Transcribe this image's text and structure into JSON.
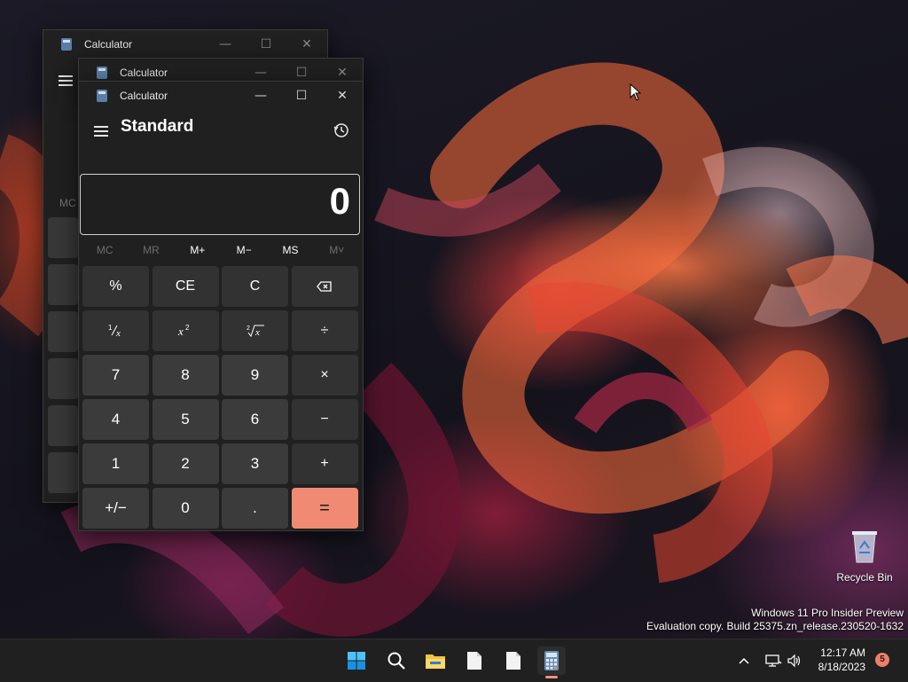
{
  "windows": {
    "back": {
      "title": "Calculator",
      "ghost_label": "MC"
    },
    "middle": {
      "title": "Calculator"
    },
    "front": {
      "title": "Calculator"
    }
  },
  "calculator": {
    "mode": "Standard",
    "display": "0",
    "memory": [
      {
        "label": "MC",
        "enabled": false
      },
      {
        "label": "MR",
        "enabled": false
      },
      {
        "label": "M+",
        "enabled": true
      },
      {
        "label": "M−",
        "enabled": true
      },
      {
        "label": "MS",
        "enabled": true
      },
      {
        "label": "M˅",
        "enabled": false
      }
    ],
    "keys": {
      "percent": "%",
      "ce": "CE",
      "c": "C",
      "divide": "÷",
      "seven": "7",
      "eight": "8",
      "nine": "9",
      "multiply": "×",
      "four": "4",
      "five": "5",
      "six": "6",
      "minus": "−",
      "one": "1",
      "two": "2",
      "three": "3",
      "plus": "+",
      "negate": "+/−",
      "zero": "0",
      "decimal": ".",
      "equals": "="
    }
  },
  "desktop": {
    "recycle_bin_label": "Recycle Bin",
    "watermark_line1": "Windows 11 Pro Insider Preview",
    "watermark_line2": "Evaluation copy. Build 25375.zn_release.230520-1632"
  },
  "taskbar": {
    "time": "12:17 AM",
    "date": "8/18/2023",
    "notification_count": "5",
    "icons": [
      "start-icon",
      "search-icon",
      "file-explorer-icon",
      "notepad-icon",
      "notepad-icon",
      "calculator-icon"
    ]
  },
  "colors": {
    "accent": "#f08a73",
    "window_bg": "#202020",
    "key_bg": "#3b3b3b",
    "taskbar_bg": "#202020"
  }
}
